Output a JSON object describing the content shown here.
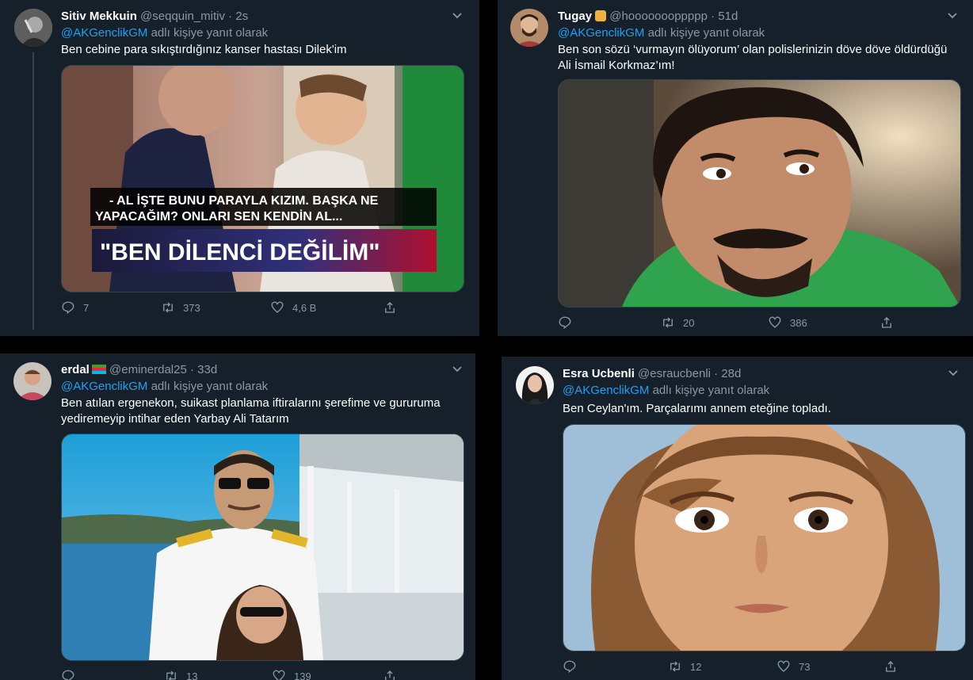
{
  "tweets": [
    {
      "name": "Sitiv Mekkuin",
      "handle": "@seqquin_mitiv",
      "time": "· 2s",
      "reply_prefix": "",
      "mention": "@AKGenclikGM",
      "reply_suffix": " adlı kişiye yanıt olarak",
      "text": "Ben cebine para sıkıştırdığınız kanser hastası Dilek'im",
      "caption_line1": "- AL İŞTE BUNU PARAYLA KIZIM. BAŞKA NE",
      "caption_line2": "YAPACAĞIM? ONLARI SEN KENDİN AL...",
      "banner": "\"BEN DİLENCİ DEĞİLİM\"",
      "replies": "7",
      "retweets": "373",
      "likes": "4,6 B"
    },
    {
      "name": "Tugay",
      "handle": "@hoooooooppppp",
      "time": "· 51d",
      "mention": "@AKGenclikGM",
      "reply_suffix": " adlı kişiye yanıt olarak",
      "text_line1": "Ben son sözü ‘vurmayın ölüyorum’ olan polislerinizin döve döve öldürdüğü",
      "text_line2": "Ali İsmail Korkmaz’ım!",
      "replies": "",
      "retweets": "20",
      "likes": "386"
    },
    {
      "name": "erdal",
      "handle": "@eminerdal25",
      "time": "· 33d",
      "mention": "@AKGenclikGM",
      "reply_suffix": " adlı kişiye yanıt olarak",
      "text_line1": "Ben atılan ergenekon, suikast planlama iftiralarını şerefime ve gururuma",
      "text_line2": "yediremeyip intihar eden Yarbay Ali Tatarım",
      "replies": "",
      "retweets": "13",
      "likes": "139"
    },
    {
      "name": "Esra Ucbenli",
      "handle": "@esraucbenli",
      "time": "· 28d",
      "mention": "@AKGenclikGM",
      "reply_suffix": " adlı kişiye yanıt olarak",
      "text": "Ben Ceylan'ım. Parçalarımı annem eteğine topladı.",
      "replies": "",
      "retweets": "12",
      "likes": "73"
    }
  ],
  "icons": {
    "reply": "reply-icon",
    "retweet": "retweet-icon",
    "like": "heart-icon",
    "share": "share-icon",
    "more": "chevron-down-icon"
  },
  "colors": {
    "background": "#15202b",
    "accent": "#1da1f2",
    "muted": "#8899a6"
  }
}
